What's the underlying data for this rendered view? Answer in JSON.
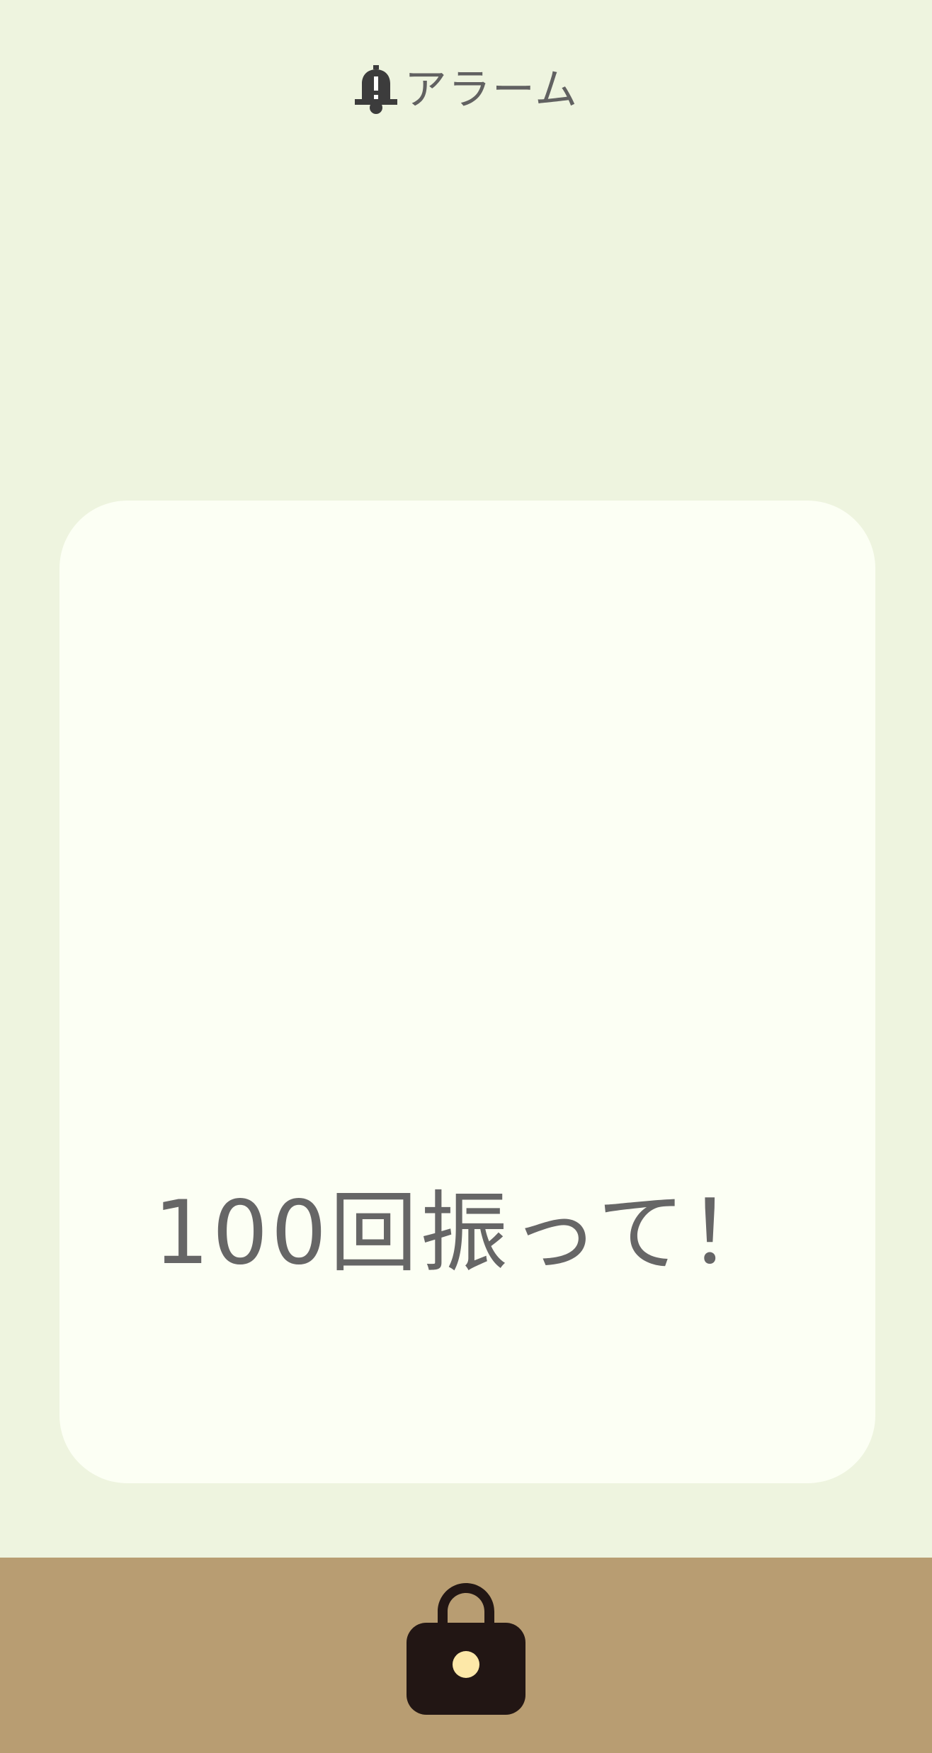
{
  "header": {
    "icon": "alarm-bell-icon",
    "title": "アラーム"
  },
  "card": {
    "message": "100回振って！"
  },
  "footer": {
    "icon": "lock-icon"
  },
  "colors": {
    "background": "#eef4df",
    "card": "#fcfff4",
    "text": "#666666",
    "footer": "#b89d72",
    "lock_body": "#221614",
    "lock_keyhole": "#fde8a8"
  }
}
